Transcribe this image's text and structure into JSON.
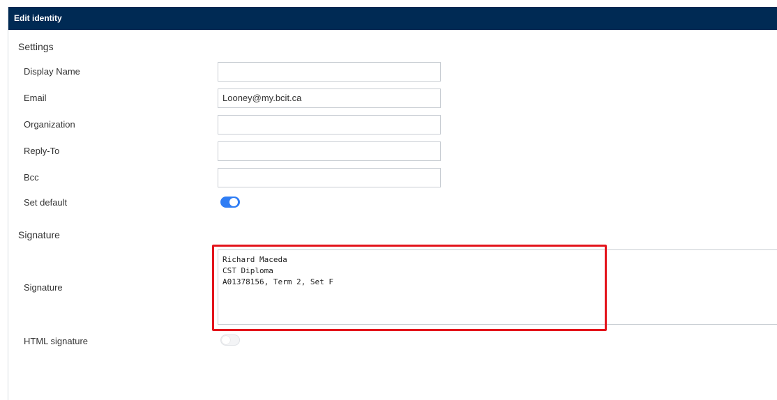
{
  "dialog": {
    "title": "Edit identity"
  },
  "settings": {
    "section_title": "Settings",
    "display_name": {
      "label": "Display Name",
      "value": ""
    },
    "email": {
      "label": "Email",
      "value": "Looney@my.bcit.ca"
    },
    "organization": {
      "label": "Organization",
      "value": ""
    },
    "reply_to": {
      "label": "Reply-To",
      "value": ""
    },
    "bcc": {
      "label": "Bcc",
      "value": ""
    },
    "set_default": {
      "label": "Set default",
      "checked": true
    }
  },
  "signature": {
    "section_title": "Signature",
    "label": "Signature",
    "lines": [
      "Richard Maceda",
      "CST Diploma",
      "A01378156, Term 2, Set F"
    ],
    "html_signature": {
      "label": "HTML signature",
      "checked": false
    }
  },
  "colors": {
    "header_bg": "#002a54",
    "toggle_on": "#2f7df4",
    "highlight": "#e3141b"
  }
}
